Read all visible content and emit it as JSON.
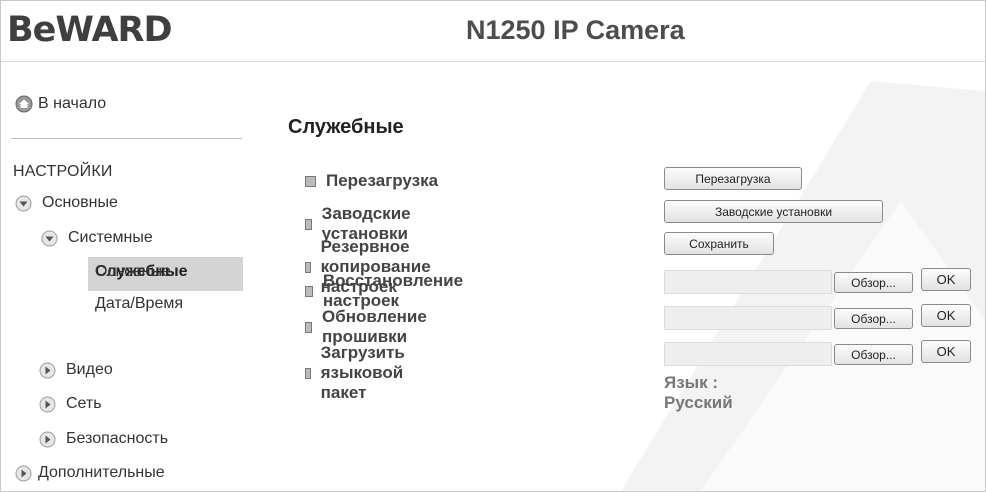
{
  "header": {
    "logo": "BeWARD",
    "title": "N1250 IP Camera"
  },
  "sidebar": {
    "home_label": "В начало",
    "section_title": "НАСТРОЙКИ",
    "items": {
      "basic": "Основные",
      "system": "Системные",
      "system_basic": "Основные",
      "datetime": "Дата/Время",
      "service": "Служебные",
      "video": "Видео",
      "network": "Сеть",
      "security": "Безопасность",
      "additional": "Дополнительные"
    }
  },
  "main": {
    "page_title": "Служебные",
    "rows": {
      "reboot": {
        "label": "Перезагрузка",
        "button": "Перезагрузка"
      },
      "factory": {
        "label": "Заводские установки",
        "button": "Заводские установки"
      },
      "backup": {
        "label": "Резервное копирование настроек",
        "button": "Сохранить"
      },
      "restore": {
        "label": "Восстановление настроек",
        "browse": "Обзор...",
        "ok": "OK"
      },
      "firmware": {
        "label": "Обновление прошивки",
        "browse": "Обзор...",
        "ok": "OK"
      },
      "langpack": {
        "label": "Загрузить языковой пакет",
        "browse": "Обзор...",
        "ok": "OK"
      }
    },
    "language_text": "Язык : Русский"
  },
  "icons": {
    "home": "home-icon",
    "expanded": "chevron-down-icon",
    "collapsed": "chevron-right-icon"
  }
}
